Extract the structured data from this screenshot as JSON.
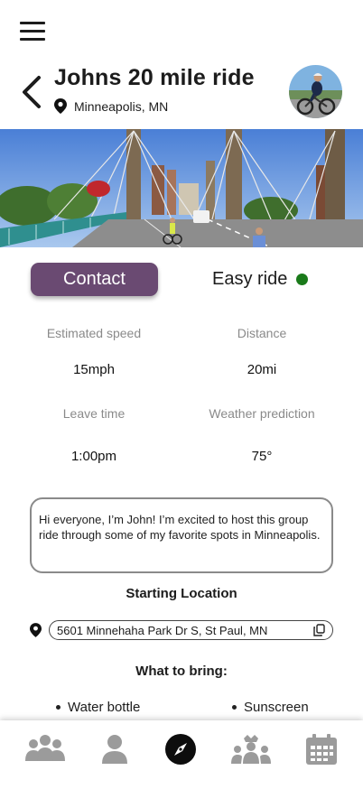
{
  "header": {
    "title": "Johns 20 mile ride",
    "location": "Minneapolis, MN",
    "icons": {
      "menu": "hamburger-menu-icon",
      "back": "chevron-left-icon",
      "location": "map-pin-icon"
    }
  },
  "actions": {
    "contact_label": "Contact",
    "difficulty_label": "Easy ride",
    "difficulty_color": "#1a7a1a",
    "accent_color": "#6a4a72"
  },
  "stats": {
    "speed_label": "Estimated speed",
    "speed_value": "15mph",
    "distance_label": "Distance",
    "distance_value": "20mi",
    "leave_label": "Leave time",
    "leave_value": "1:00pm",
    "weather_label": "Weather prediction",
    "weather_value": "75°"
  },
  "message": "Hi everyone, I’m John! I’m excited to host this group ride through some of my favorite spots in Minneapolis.",
  "starting": {
    "title": "Starting Location",
    "address": "5601 Minnehaha Park Dr S, St Paul, MN",
    "copy_icon": "copy-icon"
  },
  "bring": {
    "title": "What to bring:",
    "items_left": [
      "Water bottle"
    ],
    "items_right": [
      "Sunscreen"
    ]
  },
  "nav": {
    "items": [
      "groups-icon",
      "profile-icon",
      "explore-compass-icon",
      "community-icon",
      "calendar-icon"
    ]
  }
}
